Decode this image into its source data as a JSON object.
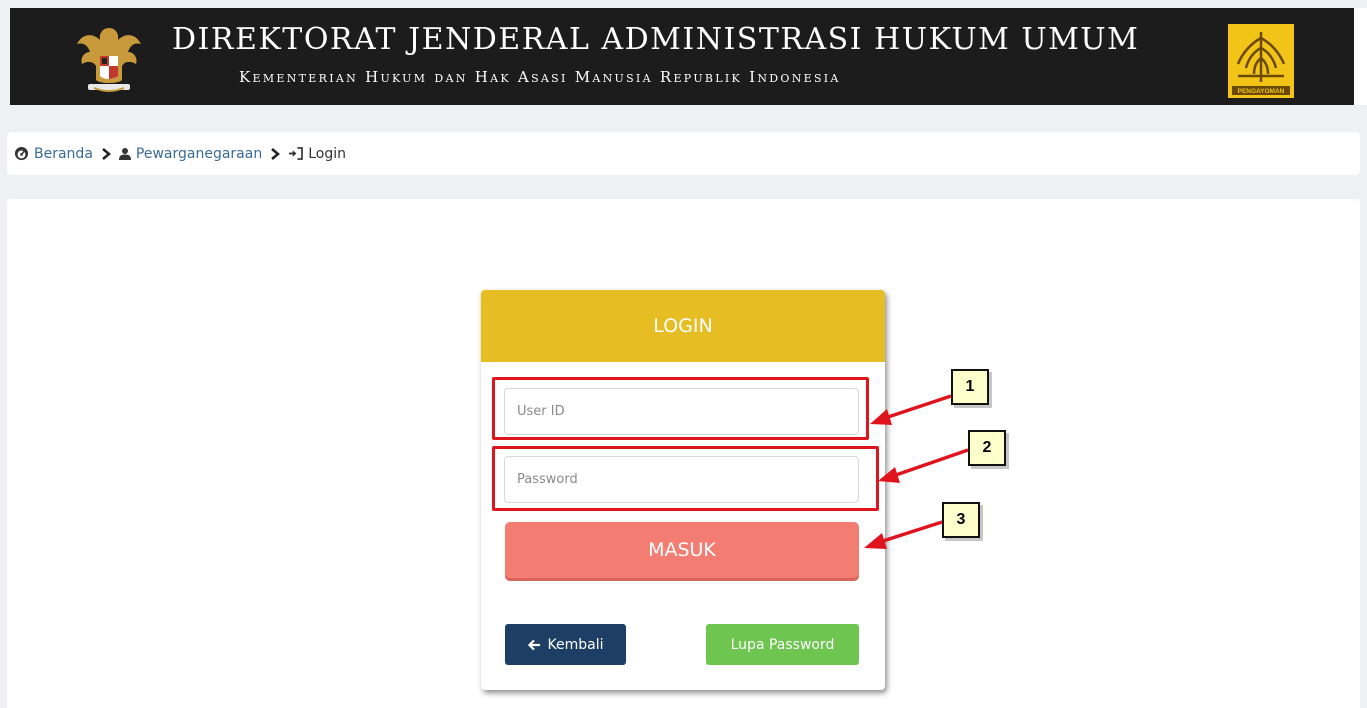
{
  "header": {
    "title": "DIREKTORAT JENDERAL ADMINISTRASI HUKUM UMUM",
    "subtitle": "Kementerian Hukum dan Hak Asasi Manusia Republik Indonesia",
    "logo_right_text": "PENGAYOMAN"
  },
  "breadcrumb": {
    "items": [
      {
        "label": "Beranda",
        "icon": "dashboard-icon"
      },
      {
        "label": "Pewarganegaraan",
        "icon": "user-icon"
      },
      {
        "label": "Login",
        "icon": "sign-in-icon"
      }
    ]
  },
  "login": {
    "title": "LOGIN",
    "user_placeholder": "User ID",
    "password_placeholder": "Password",
    "submit_label": "MASUK",
    "back_label": "Kembali",
    "forgot_label": "Lupa Password"
  },
  "annotations": [
    "1",
    "2",
    "3"
  ],
  "colors": {
    "header_bg": "#1c1c1c",
    "login_header": "#e6bd22",
    "submit_button": "#f47d73",
    "back_button": "#1d3f66",
    "forgot_button": "#6ec550",
    "annotation_red": "#e0141e",
    "annotation_label_bg": "#ffffcc"
  }
}
